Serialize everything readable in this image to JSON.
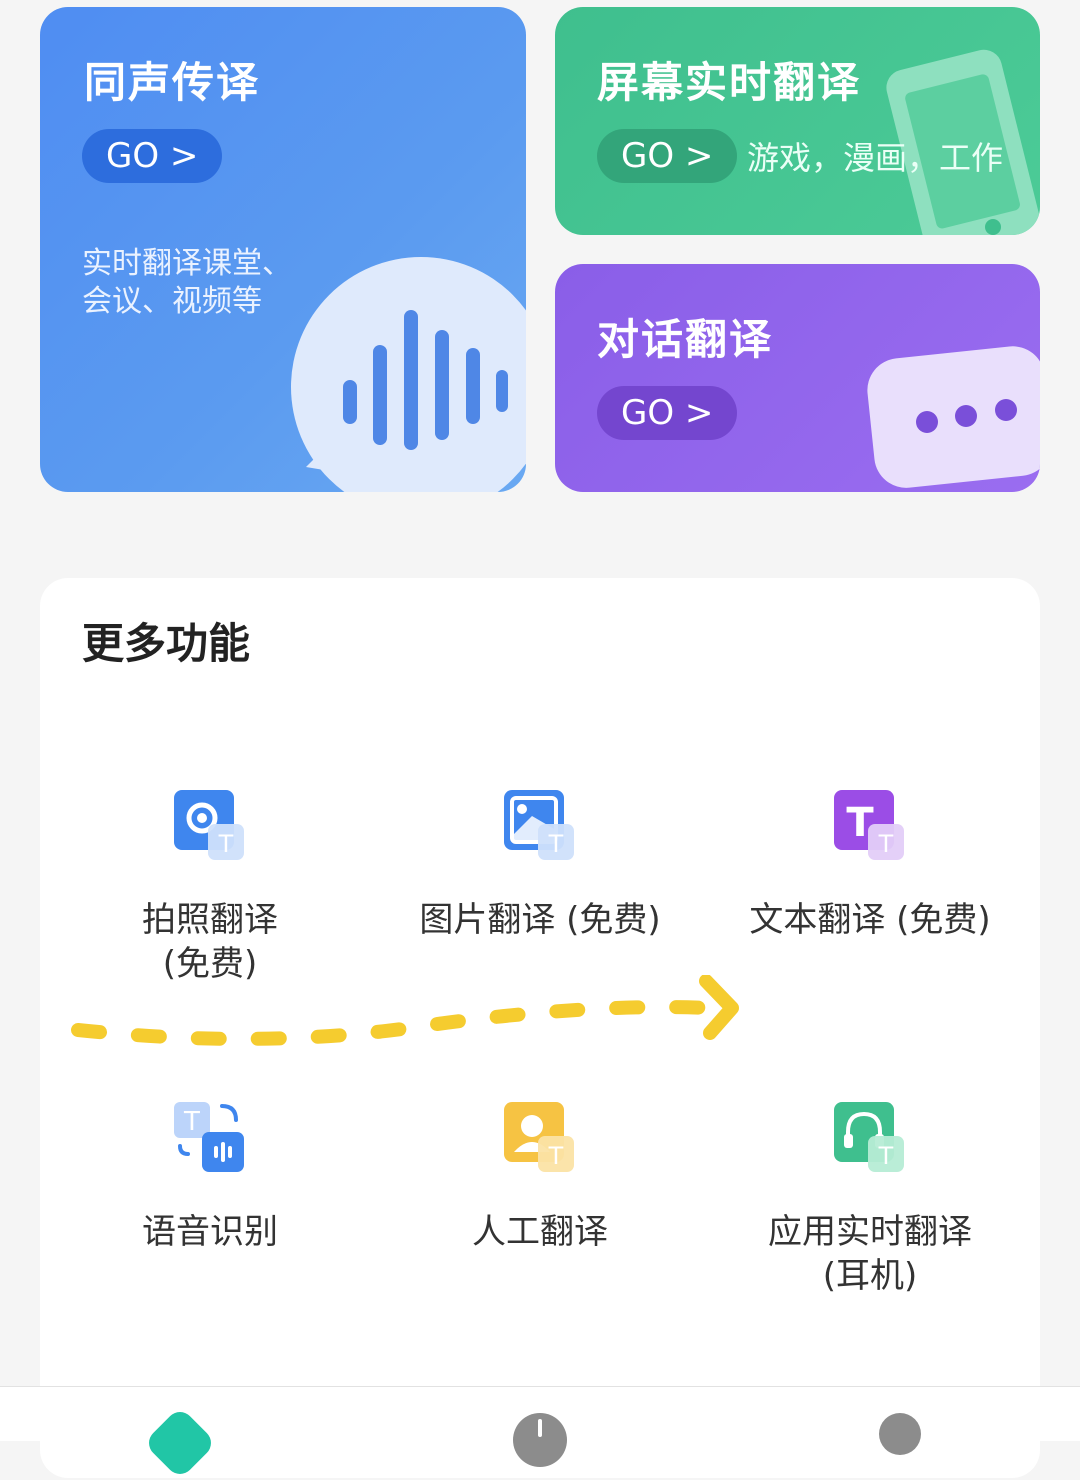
{
  "cards": {
    "simultaneous": {
      "title": "同声传译",
      "go": "GO >",
      "desc_line1": "实时翻译课堂、",
      "desc_line2": "会议、视频等",
      "icon": "voice-bubble-icon"
    },
    "screen": {
      "title": "屏幕实时翻译",
      "go": "GO >",
      "desc": "游戏，漫画，工作",
      "icon": "phone-icon"
    },
    "dialogue": {
      "title": "对话翻译",
      "go": "GO >",
      "icon": "chat-bubble-icon"
    }
  },
  "more": {
    "title": "更多功能",
    "items": [
      {
        "label_line1": "拍照翻译",
        "label_line2": "(免费)",
        "icon": "camera-translate-icon"
      },
      {
        "label_line1": "图片翻译 (免费)",
        "label_line2": "",
        "icon": "image-translate-icon"
      },
      {
        "label_line1": "文本翻译 (免费)",
        "label_line2": "",
        "icon": "text-translate-icon"
      },
      {
        "label_line1": "语音识别",
        "label_line2": "",
        "icon": "speech-recognition-icon"
      },
      {
        "label_line1": "人工翻译",
        "label_line2": "",
        "icon": "human-translate-icon"
      },
      {
        "label_line1": "应用实时翻译",
        "label_line2": "(耳机)",
        "icon": "headset-translate-icon"
      }
    ]
  },
  "annotation": {
    "icon": "yellow-dashed-arrow"
  },
  "tabbar": {
    "items": [
      {
        "icon": "home-tab-icon"
      },
      {
        "icon": "gray-tab-icon"
      },
      {
        "icon": "profile-tab-icon"
      }
    ]
  },
  "colors": {
    "blue": "#4f8cf0",
    "green": "#48c995",
    "purple": "#8d63ea",
    "arrow": "#f5cc2f"
  }
}
